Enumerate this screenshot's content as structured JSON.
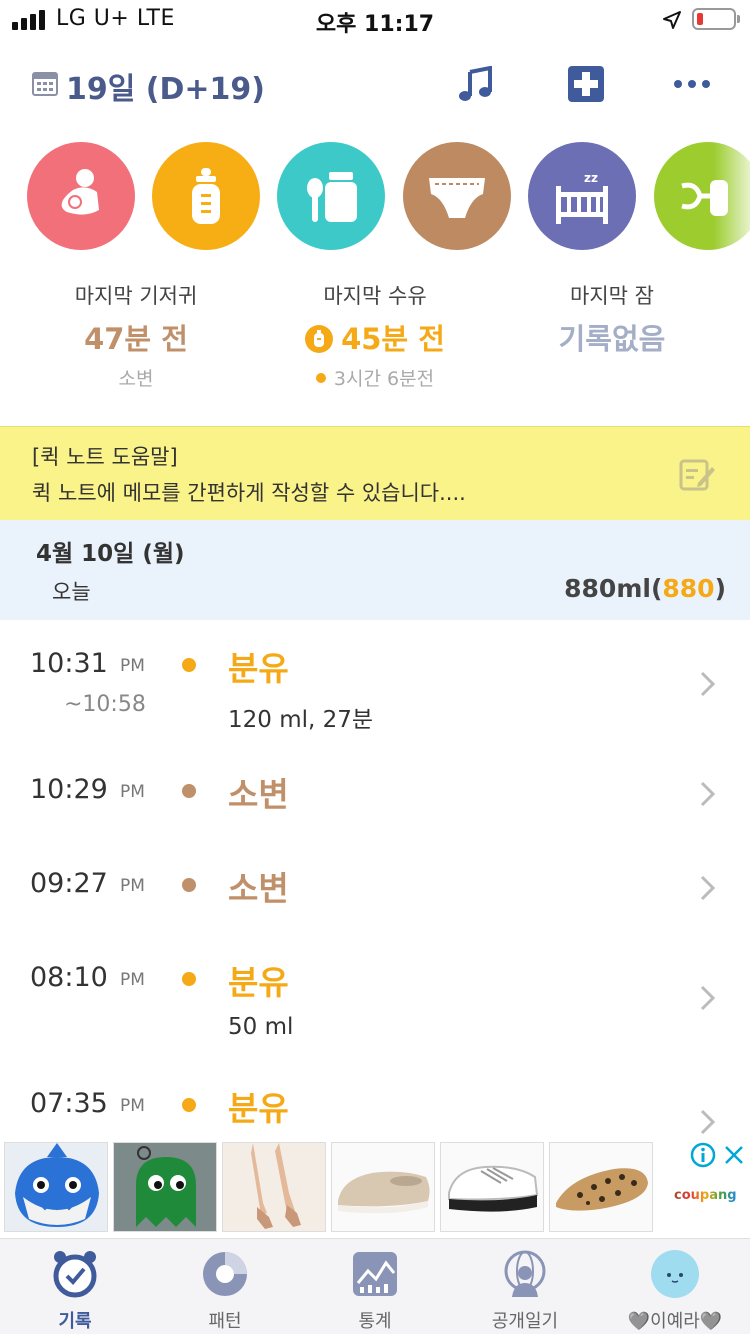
{
  "status_bar": {
    "carrier": "LG U+   LTE",
    "time": "오후 11:17"
  },
  "header": {
    "day_label": "19일 (D+19)",
    "icons": [
      "calendar-icon",
      "music-icon",
      "medical-plus-icon",
      "more-icon"
    ]
  },
  "quick_buttons": [
    {
      "name": "breastfeed",
      "color": "#f2707a"
    },
    {
      "name": "bottle",
      "color": "#f7ae14"
    },
    {
      "name": "baby-food",
      "color": "#3ec9c9"
    },
    {
      "name": "diaper",
      "color": "#bd8a62"
    },
    {
      "name": "sleep",
      "color": "#6c6fb3"
    },
    {
      "name": "pumping",
      "color": "#9ccc2e"
    }
  ],
  "summary": {
    "diaper": {
      "label": "마지막 기저귀",
      "value": "47분 전",
      "sub": "소변"
    },
    "feeding": {
      "label": "마지막 수유",
      "value": "45분 전",
      "sub": "3시간 6분전"
    },
    "sleep": {
      "label": "마지막 잠",
      "value": "기록없음"
    }
  },
  "quick_note": {
    "title": "[퀵 노트 도움말]",
    "body": "퀵 노트에 메모를 간편하게 작성할 수 있습니다...."
  },
  "date_section": {
    "date": "4월 10일 (월)",
    "today_label": "오늘",
    "total_prefix": "880ml(",
    "total_accent": "880",
    "total_suffix": ")"
  },
  "records": [
    {
      "time": "10:31",
      "ampm": "PM",
      "end": "~10:58",
      "title": "분유",
      "detail": "120 ml, 27분",
      "type": "formula"
    },
    {
      "time": "10:29",
      "ampm": "PM",
      "end": "",
      "title": "소변",
      "detail": "",
      "type": "urine"
    },
    {
      "time": "09:27",
      "ampm": "PM",
      "end": "",
      "title": "소변",
      "detail": "",
      "type": "urine"
    },
    {
      "time": "08:10",
      "ampm": "PM",
      "end": "",
      "title": "분유",
      "detail": "50 ml",
      "type": "formula"
    },
    {
      "time": "07:35",
      "ampm": "PM",
      "end": "",
      "title": "분유",
      "detail": "",
      "type": "formula"
    }
  ],
  "colors": {
    "formula": "#f5a916",
    "urine": "#c0906a",
    "primary": "#3f5b9b"
  },
  "ad": {
    "brand": "coupang",
    "products": [
      "shark-bag",
      "green-ghost-pouch",
      "nude-heels",
      "beige-slip-on",
      "white-sneakers",
      "leopard-flats"
    ]
  },
  "tabs": [
    {
      "label": "기록",
      "icon": "alarm-clock-icon",
      "active": true
    },
    {
      "label": "패턴",
      "icon": "pattern-dial-icon",
      "active": false
    },
    {
      "label": "통계",
      "icon": "chart-icon",
      "active": false
    },
    {
      "label": "공개일기",
      "icon": "globe-person-icon",
      "active": false
    },
    {
      "label": "🩶이예라🩶",
      "icon": "baby-face-icon",
      "active": false
    }
  ]
}
